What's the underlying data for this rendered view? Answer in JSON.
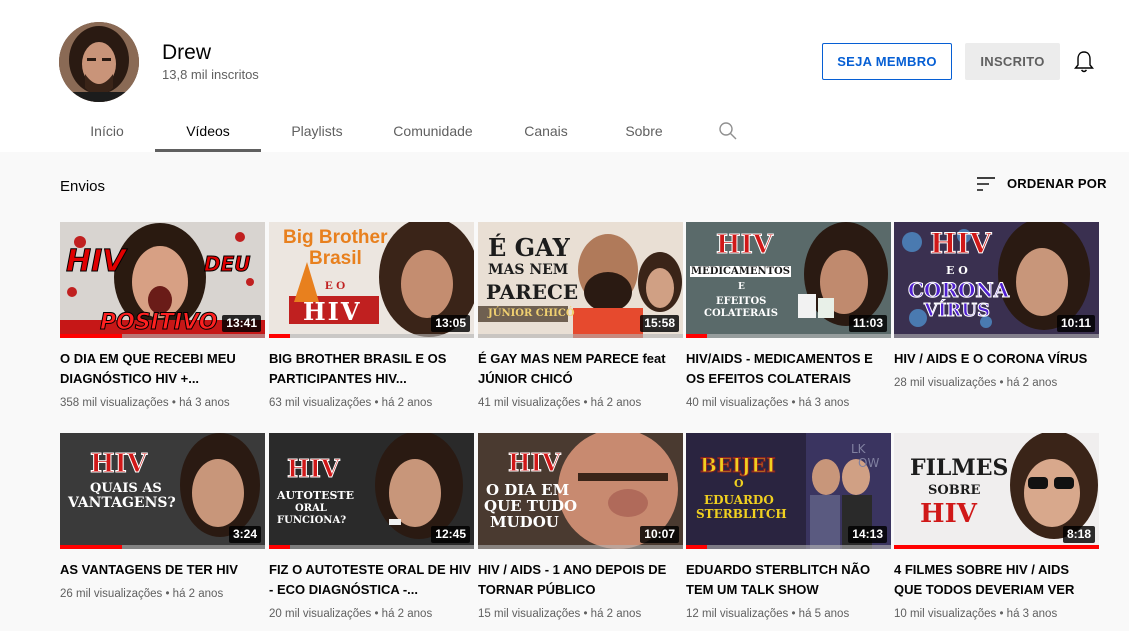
{
  "channel": {
    "name": "Drew",
    "subscribers": "13,8 mil inscritos",
    "member_label": "SEJA MEMBRO",
    "subscribed_label": "INSCRITO"
  },
  "tabs": [
    {
      "label": "Início"
    },
    {
      "label": "Vídeos"
    },
    {
      "label": "Playlists"
    },
    {
      "label": "Comunidade"
    },
    {
      "label": "Canais"
    },
    {
      "label": "Sobre"
    }
  ],
  "section": {
    "title": "Envios",
    "sort_label": "ORDENAR POR"
  },
  "videos": [
    {
      "title": "O DIA EM QUE RECEBI MEU DIAGNÓSTICO HIV +...",
      "meta": "358 mil visualizações • há 3 anos",
      "duration": "13:41",
      "progress": 0.3,
      "thumb_text": [
        "HIV",
        "DEU",
        "POSITIVO"
      ]
    },
    {
      "title": "BIG BROTHER BRASIL E OS PARTICIPANTES HIV...",
      "meta": "63 mil visualizações • há 2 anos",
      "duration": "13:05",
      "progress": 0.1,
      "thumb_text": [
        "Big Brother",
        "Brasil",
        "E O",
        "HIV"
      ]
    },
    {
      "title": "É GAY MAS NEM PARECE feat JÚNIOR CHICÓ",
      "meta": "41 mil visualizações • há 2 anos",
      "duration": "15:58",
      "progress": 0,
      "thumb_text": [
        "É GAY",
        "MAS NEM",
        "PARECE",
        "JÚNIOR CHICÓ"
      ]
    },
    {
      "title": "HIV/AIDS - MEDICAMENTOS E OS EFEITOS COLATERAIS",
      "meta": "40 mil visualizações • há 3 anos",
      "duration": "11:03",
      "progress": 0.1,
      "thumb_text": [
        "HIV",
        "MEDICAMENTOS",
        "E",
        "EFEITOS",
        "COLATERAIS"
      ]
    },
    {
      "title": "HIV / AIDS E O CORONA VÍRUS",
      "meta": "28 mil visualizações • há 2 anos",
      "duration": "10:11",
      "progress": 0,
      "thumb_text": [
        "HIV",
        "E O",
        "CORONA",
        "VÍRUS"
      ]
    },
    {
      "title": "AS VANTAGENS DE TER HIV",
      "meta": "26 mil visualizações • há 2 anos",
      "duration": "3:24",
      "progress": 0.3,
      "thumb_text": [
        "HIV",
        "QUAIS AS",
        "VANTAGENS?"
      ]
    },
    {
      "title": "FIZ O AUTOTESTE ORAL DE HIV - ECO DIAGNÓSTICA -...",
      "meta": "20 mil visualizações • há 2 anos",
      "duration": "12:45",
      "progress": 0.1,
      "thumb_text": [
        "HIV",
        "AUTOTESTE",
        "ORAL",
        "FUNCIONA?"
      ]
    },
    {
      "title": "HIV / AIDS - 1 ANO DEPOIS DE TORNAR PÚBLICO",
      "meta": "15 mil visualizações • há 2 anos",
      "duration": "10:07",
      "progress": 0,
      "thumb_text": [
        "HIV",
        "O DIA EM",
        "QUE TUDO",
        "MUDOU"
      ]
    },
    {
      "title": "EDUARDO STERBLITCH NÃO TEM UM TALK SHOW",
      "meta": "12 mil visualizações • há 5 anos",
      "duration": "14:13",
      "progress": 0.1,
      "thumb_text": [
        "BEIJEI",
        "O",
        "EDUARDO",
        "STERBLITCH"
      ]
    },
    {
      "title": "4 FILMES SOBRE HIV / AIDS QUE TODOS DEVERIAM VER",
      "meta": "10 mil visualizações • há 3 anos",
      "duration": "8:18",
      "progress": 1,
      "thumb_text": [
        "FILMES",
        "SOBRE",
        "HIV"
      ]
    }
  ]
}
